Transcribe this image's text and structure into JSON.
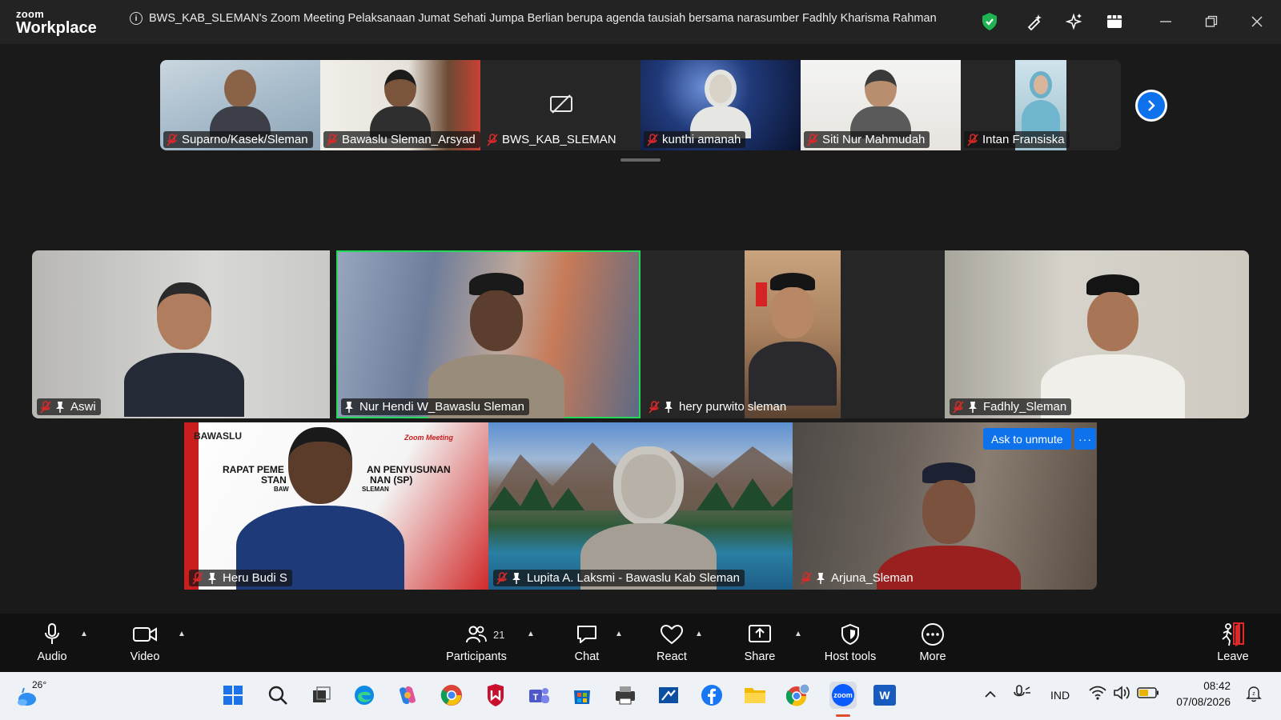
{
  "app": {
    "logo_line1": "zoom",
    "logo_line2": "Workplace",
    "meeting_title": "BWS_KAB_SLEMAN's Zoom Meeting Pelaksanaan Jumat Sehati Jumpa Berlian berupa agenda tausiah bersama narasumber Fadhly Kharisma Rahman"
  },
  "title_icons": [
    "shield-check-icon",
    "pen-sparkle-icon",
    "ai-sparkle-icon",
    "apps-grid-icon",
    "minimize-icon",
    "restore-icon",
    "close-icon"
  ],
  "colors": {
    "accent": "#0e72ed",
    "active_speaker": "#23d959",
    "mute_red": "#e02828",
    "leave_red": "#e02828"
  },
  "strip": {
    "participants": [
      {
        "name": "Suparno/Kasek/Sleman"
      },
      {
        "name": "Bawaslu Sleman_Arsyad"
      },
      {
        "name": "BWS_KAB_SLEMAN",
        "video_off": true
      },
      {
        "name": "kunthi amanah"
      },
      {
        "name": "Siti Nur Mahmudah"
      },
      {
        "name": "Intan Fransiska"
      }
    ]
  },
  "grid": {
    "tiles": [
      {
        "name": "Aswi"
      },
      {
        "name": "Nur Hendi W_Bawaslu Sleman"
      },
      {
        "name": "hery purwito sleman"
      },
      {
        "name": "Fadhly_Sleman"
      },
      {
        "name": "Heru Budi S",
        "background_text": [
          "BAWASLU",
          "Zoom Meeting",
          "RAPAT PEME",
          "AN PENYUSUNAN",
          "STAN",
          "NAN (SP)",
          "BAW",
          "SLEMAN"
        ]
      },
      {
        "name": "Lupita A. Laksmi - Bawaslu Kab Sleman"
      },
      {
        "name": "Arjuna_Sleman"
      }
    ],
    "ask_to_unmute": "Ask to unmute",
    "more_options": "···"
  },
  "toolbar": {
    "audio": "Audio",
    "video": "Video",
    "participants": "Participants",
    "participants_count": "21",
    "chat": "Chat",
    "react": "React",
    "share": "Share",
    "host_tools": "Host tools",
    "more": "More",
    "leave": "Leave"
  },
  "taskbar": {
    "weather_temp": "26°",
    "apps": [
      "windows-start-icon",
      "search-icon",
      "task-view-icon",
      "edge-icon",
      "copilot-icon",
      "chrome-icon",
      "mcafee-icon",
      "teams-icon",
      "store-icon",
      "printer-icon",
      "remote-desktop-icon",
      "facebook-icon",
      "file-explorer-icon",
      "chrome-profile-icon",
      "zoom-icon",
      "word-icon"
    ],
    "zoom_label": "zoom",
    "word_label": "W",
    "language": "IND",
    "time": "08:42",
    "date": "07/08/2026"
  }
}
